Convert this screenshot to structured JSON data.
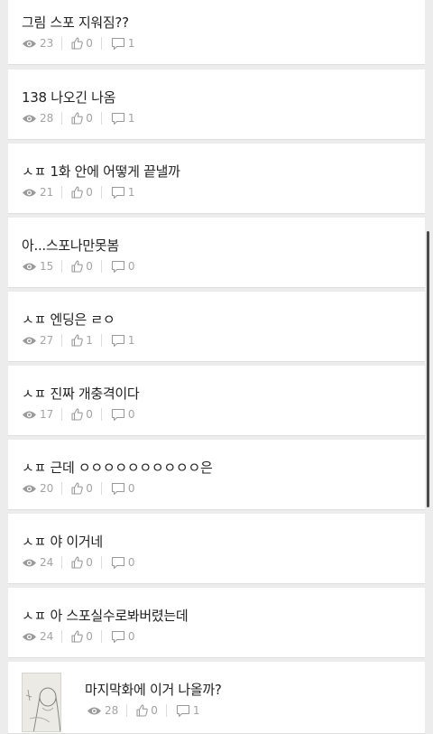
{
  "posts": [
    {
      "title": "그림 스포 지워짐??",
      "views": "23",
      "likes": "0",
      "comments": "1"
    },
    {
      "title": "138 나오긴 나옴",
      "views": "28",
      "likes": "0",
      "comments": "1"
    },
    {
      "title": "ㅅㅍ 1화 안에 어떻게 끝낼까",
      "views": "21",
      "likes": "0",
      "comments": "1"
    },
    {
      "title": "아...스포나만못봄",
      "views": "15",
      "likes": "0",
      "comments": "0"
    },
    {
      "title": "ㅅㅍ 엔딩은 ㄹㅇ",
      "views": "27",
      "likes": "1",
      "comments": "1"
    },
    {
      "title": "ㅅㅍ 진짜 개충격이다",
      "views": "17",
      "likes": "0",
      "comments": "0"
    },
    {
      "title": "ㅅㅍ 근데 ㅇㅇㅇㅇㅇㅇㅇㅇㅇㅇ은",
      "views": "20",
      "likes": "0",
      "comments": "0"
    },
    {
      "title": "ㅅㅍ 야 이거네",
      "views": "24",
      "likes": "0",
      "comments": "0"
    },
    {
      "title": "ㅅㅍ 아 스포실수로봐버렸는데",
      "views": "24",
      "likes": "0",
      "comments": "0"
    },
    {
      "title": "마지막화에 이거 나올까?",
      "views": "28",
      "likes": "0",
      "comments": "1"
    }
  ],
  "icons": {
    "views": "eye-icon",
    "likes": "thumbs-up-icon",
    "comments": "comment-icon"
  },
  "colors": {
    "background": "#ececec",
    "card": "#ffffff",
    "title": "#222222",
    "meta": "#a3a3a3"
  }
}
